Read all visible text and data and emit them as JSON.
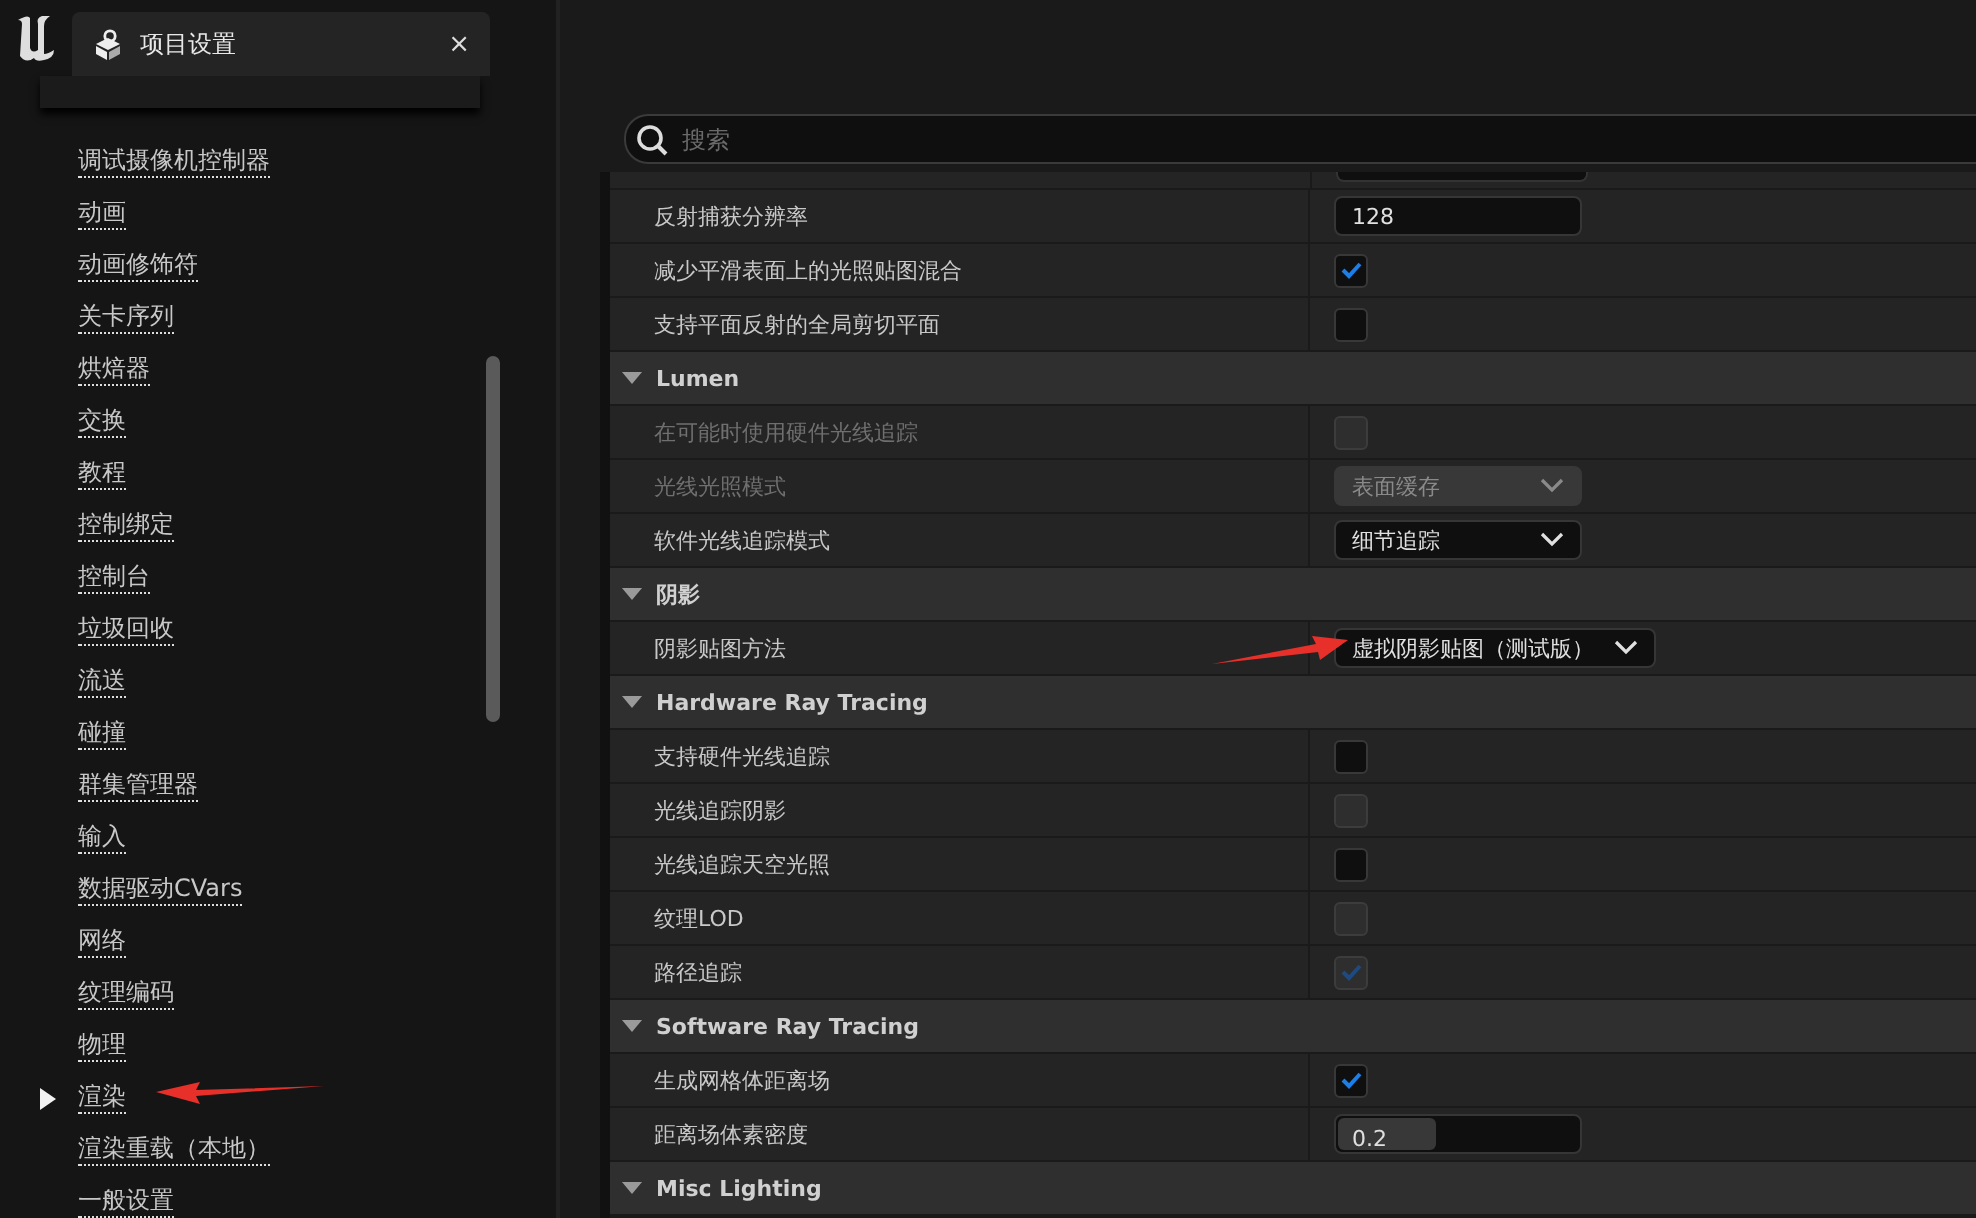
{
  "tab": {
    "title": "项目设置",
    "close": "×"
  },
  "sidebar": {
    "items": [
      {
        "label": "调试摄像机控制器",
        "selected": false
      },
      {
        "label": "动画",
        "selected": false
      },
      {
        "label": "动画修饰符",
        "selected": false
      },
      {
        "label": "关卡序列",
        "selected": false
      },
      {
        "label": "烘焙器",
        "selected": false
      },
      {
        "label": "交换",
        "selected": false
      },
      {
        "label": "教程",
        "selected": false
      },
      {
        "label": "控制绑定",
        "selected": false
      },
      {
        "label": "控制台",
        "selected": false
      },
      {
        "label": "垃圾回收",
        "selected": false
      },
      {
        "label": "流送",
        "selected": false
      },
      {
        "label": "碰撞",
        "selected": false
      },
      {
        "label": "群集管理器",
        "selected": false
      },
      {
        "label": "输入",
        "selected": false
      },
      {
        "label": "数据驱动CVars",
        "selected": false
      },
      {
        "label": "网络",
        "selected": false
      },
      {
        "label": "纹理编码",
        "selected": false
      },
      {
        "label": "物理",
        "selected": false
      },
      {
        "label": "渲染",
        "selected": true
      },
      {
        "label": "渲染重载（本地）",
        "selected": false
      },
      {
        "label": "一般设置",
        "selected": false
      }
    ]
  },
  "search": {
    "placeholder": "搜索"
  },
  "rows": [
    {
      "kind": "text",
      "label": "反射捕获分辨率",
      "value": "128",
      "label_greyed": false
    },
    {
      "kind": "checkbox",
      "label": "减少平滑表面上的光照贴图混合",
      "checked": true,
      "disabled": false,
      "label_greyed": false
    },
    {
      "kind": "checkbox",
      "label": "支持平面反射的全局剪切平面",
      "checked": false,
      "disabled": false,
      "label_greyed": false
    },
    {
      "kind": "section",
      "label": "Lumen",
      "expanded": true
    },
    {
      "kind": "checkbox",
      "label": "在可能时使用硬件光线追踪",
      "checked": false,
      "disabled": true,
      "label_greyed": true
    },
    {
      "kind": "dropdown",
      "label": "光线光照模式",
      "value": "表面缓存",
      "disabled": true,
      "label_greyed": true
    },
    {
      "kind": "dropdown",
      "label": "软件光线追踪模式",
      "value": "细节追踪",
      "disabled": false,
      "label_greyed": false
    },
    {
      "kind": "section",
      "label": "阴影",
      "expanded": true
    },
    {
      "kind": "dropdown",
      "label": "阴影贴图方法",
      "value": "虚拟阴影贴图（测试版）",
      "disabled": false,
      "label_greyed": false
    },
    {
      "kind": "section",
      "label": "Hardware Ray Tracing",
      "expanded": true
    },
    {
      "kind": "checkbox",
      "label": "支持硬件光线追踪",
      "checked": false,
      "disabled": false,
      "label_greyed": false
    },
    {
      "kind": "checkbox",
      "label": "光线追踪阴影",
      "checked": false,
      "disabled": true,
      "label_greyed": false
    },
    {
      "kind": "checkbox",
      "label": "光线追踪天空光照",
      "checked": false,
      "disabled": false,
      "label_greyed": false
    },
    {
      "kind": "checkbox",
      "label": "纹理LOD",
      "checked": false,
      "disabled": true,
      "label_greyed": false
    },
    {
      "kind": "checkbox",
      "label": "路径追踪",
      "checked": true,
      "disabled": true,
      "label_greyed": false
    },
    {
      "kind": "section",
      "label": "Software Ray Tracing",
      "expanded": true
    },
    {
      "kind": "checkbox",
      "label": "生成网格体距离场",
      "checked": true,
      "disabled": false,
      "label_greyed": false
    },
    {
      "kind": "slider",
      "label": "距离场体素密度",
      "value": "0.2",
      "level": 0.4,
      "label_greyed": false
    },
    {
      "kind": "section",
      "label": "Misc Lighting",
      "expanded": true
    }
  ]
}
